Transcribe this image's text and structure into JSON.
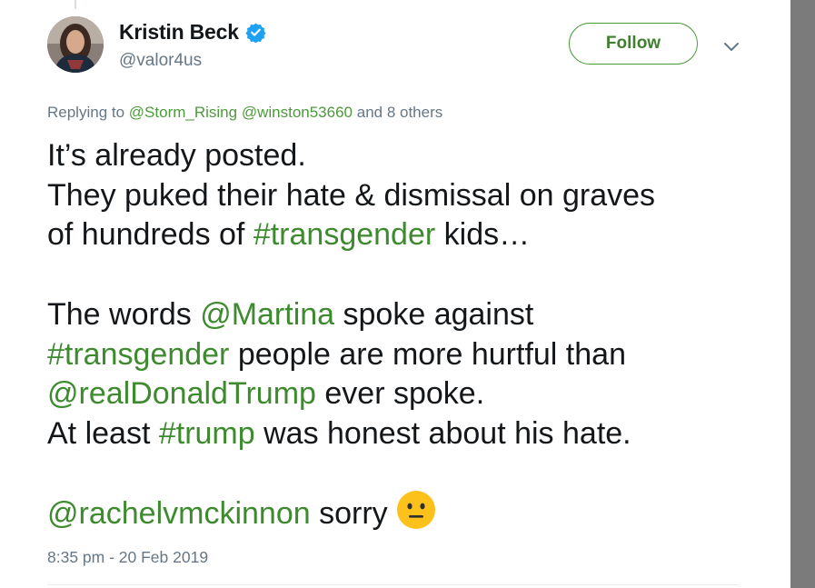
{
  "author": {
    "display_name": "Kristin Beck",
    "handle": "@valor4us",
    "verified": true
  },
  "follow_button_label": "Follow",
  "menu_icon": "chevron-down-icon",
  "reply_context": {
    "prefix": "Replying to",
    "mentions": [
      "@Storm_Rising",
      "@winston53660"
    ],
    "suffix": "and 8 others"
  },
  "tweet": {
    "line1": "It’s already posted.",
    "line2": "They puked their hate & dismissal on graves",
    "line3_pre": "of hundreds of ",
    "line3_tag": "#transgender",
    "line3_post": " kids…",
    "line4_pre": "The words ",
    "line4_mention": "@Martina",
    "line4_post": " spoke against",
    "line5_tag": "#transgender",
    "line5_post": " people are more hurtful than",
    "line6_mention": "@realDonaldTrump",
    "line6_post": " ever spoke.",
    "line7_pre": "At least ",
    "line7_tag": "#trump",
    "line7_post": " was honest about his hate.",
    "line8_mention": "@rachelvmckinnon",
    "line8_post": " sorry",
    "emoji": "neutral-face-emoji"
  },
  "timestamp": "8:35 pm - 20 Feb 2019",
  "colors": {
    "link": "#3e8a2f",
    "follow_border": "#4c9a3b",
    "muted": "#657786",
    "verified": "#1da1f2",
    "scrollbar": "#7b7b7b"
  }
}
